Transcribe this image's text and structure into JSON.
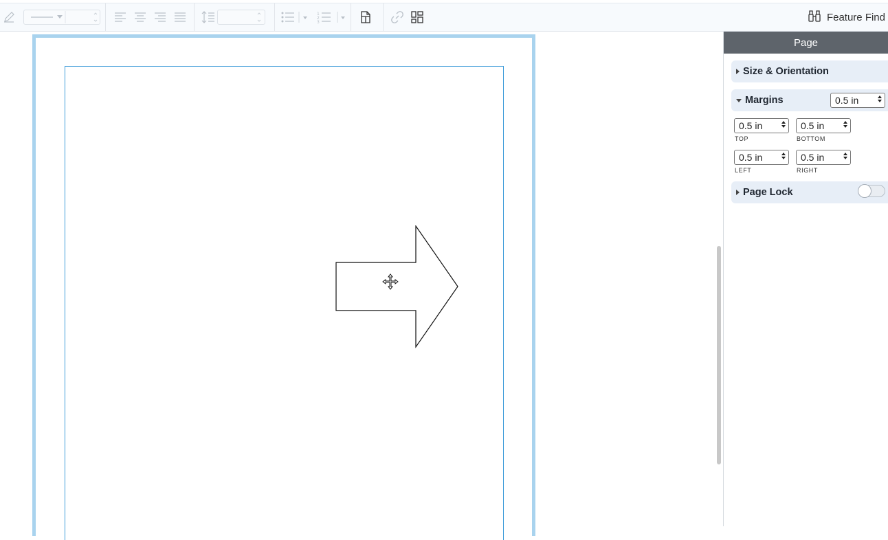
{
  "toolbar": {
    "feature_find_label": "Feature Find",
    "icons": [
      "pen-icon",
      "line-style-dropdown",
      "align-left-icon",
      "align-center-icon",
      "align-right-icon",
      "align-justify-icon",
      "line-spacing-icon",
      "bulleted-list-icon",
      "numbered-list-icon",
      "page-icon",
      "link-icon",
      "layout-icon",
      "binoculars-icon"
    ]
  },
  "panel": {
    "title": "Page",
    "size_orientation": {
      "label": "Size & Orientation"
    },
    "margins": {
      "label": "Margins",
      "all_value": "0.5 in",
      "top_value": "0.5 in",
      "bottom_value": "0.5 in",
      "left_value": "0.5 in",
      "right_value": "0.5 in",
      "top_label": "TOP",
      "bottom_label": "BOTTOM",
      "left_label": "LEFT",
      "right_label": "RIGHT"
    },
    "page_lock": {
      "label": "Page Lock",
      "enabled": false
    }
  },
  "colors": {
    "toolbar_bg": "#f7fafd",
    "page_border": "#a9d3ee",
    "margin_guide": "#3c9bd9",
    "panel_header": "#5e646b",
    "section_bg": "#e7eef7"
  }
}
